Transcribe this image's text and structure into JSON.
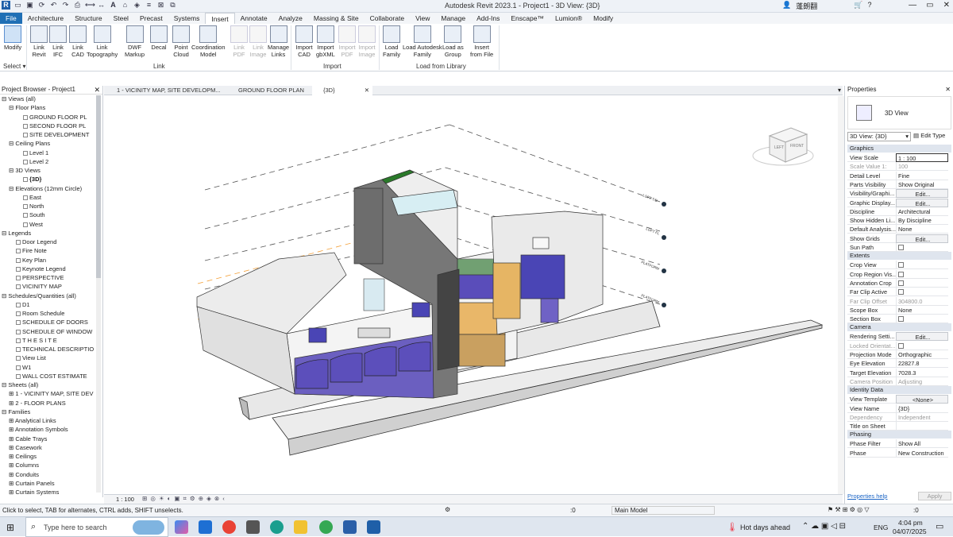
{
  "title_bar": {
    "title": "Autodesk Revit 2023.1 - Project1 - 3D View: {3D}",
    "user_label": "蓬朗翻",
    "window_controls": [
      "—",
      "▭",
      "✕"
    ]
  },
  "tabs": [
    "File",
    "Architecture",
    "Structure",
    "Steel",
    "Precast",
    "Systems",
    "Insert",
    "Annotate",
    "Analyze",
    "Massing & Site",
    "Collaborate",
    "View",
    "Manage",
    "Add-Ins",
    "Enscape™",
    "Lumion®",
    "Modify"
  ],
  "active_tab": "Insert",
  "ribbon": {
    "buttons": [
      {
        "l1": "Modify",
        "l2": "",
        "state": "sel"
      },
      {
        "l1": "Link",
        "l2": "Revit",
        "state": ""
      },
      {
        "l1": "Link",
        "l2": "IFC",
        "state": ""
      },
      {
        "l1": "Link",
        "l2": "CAD",
        "state": ""
      },
      {
        "l1": "Link",
        "l2": "Topography",
        "state": ""
      },
      {
        "l1": "DWF",
        "l2": "Markup",
        "state": ""
      },
      {
        "l1": "Decal",
        "l2": "",
        "state": ""
      },
      {
        "l1": "Point",
        "l2": "Cloud",
        "state": ""
      },
      {
        "l1": "Coordination",
        "l2": "Model",
        "state": ""
      },
      {
        "l1": "Link",
        "l2": "PDF",
        "state": "dis"
      },
      {
        "l1": "Link",
        "l2": "Image",
        "state": "dis"
      },
      {
        "l1": "Manage",
        "l2": "Links",
        "state": ""
      },
      {
        "l1": "Import",
        "l2": "CAD",
        "state": ""
      },
      {
        "l1": "Import",
        "l2": "gbXML",
        "state": ""
      },
      {
        "l1": "Import",
        "l2": "PDF",
        "state": "dis"
      },
      {
        "l1": "Import",
        "l2": "Image",
        "state": "dis"
      },
      {
        "l1": "Load",
        "l2": "Family",
        "state": ""
      },
      {
        "l1": "Load Autodesk",
        "l2": "Family",
        "state": ""
      },
      {
        "l1": "Load as",
        "l2": "Group",
        "state": ""
      },
      {
        "l1": "Insert",
        "l2": "from File",
        "state": ""
      }
    ],
    "groups": {
      "select": "Select ▾",
      "link": "Link",
      "import": "Import",
      "load": "Load from Library"
    }
  },
  "project_browser": {
    "title": "Project Browser - Project1",
    "rows": [
      {
        "t": "Views (all)",
        "d": 0,
        "e": "⊟"
      },
      {
        "t": "Floor Plans",
        "d": 1,
        "e": "⊟"
      },
      {
        "t": "GROUND FLOOR PL",
        "d": 3,
        "e": "",
        "b": 1
      },
      {
        "t": "SECOND FLOOR PL",
        "d": 3,
        "e": "",
        "b": 1
      },
      {
        "t": "SITE DEVELOPMENT",
        "d": 3,
        "e": "",
        "b": 1
      },
      {
        "t": "Ceiling Plans",
        "d": 1,
        "e": "⊟"
      },
      {
        "t": "Level 1",
        "d": 3,
        "e": "",
        "b": 1
      },
      {
        "t": "Level 2",
        "d": 3,
        "e": "",
        "b": 1
      },
      {
        "t": "3D Views",
        "d": 1,
        "e": "⊟"
      },
      {
        "t": "{3D}",
        "d": 3,
        "e": "",
        "b": 1,
        "bold": 1
      },
      {
        "t": "Elevations (12mm Circle)",
        "d": 1,
        "e": "⊟"
      },
      {
        "t": "East",
        "d": 3,
        "e": "",
        "b": 1
      },
      {
        "t": "North",
        "d": 3,
        "e": "",
        "b": 1
      },
      {
        "t": "South",
        "d": 3,
        "e": "",
        "b": 1
      },
      {
        "t": "West",
        "d": 3,
        "e": "",
        "b": 1
      },
      {
        "t": "Legends",
        "d": 0,
        "e": "⊟"
      },
      {
        "t": "Door Legend",
        "d": 2,
        "e": "",
        "b": 1
      },
      {
        "t": "Fire Note",
        "d": 2,
        "e": "",
        "b": 1
      },
      {
        "t": "Key Plan",
        "d": 2,
        "e": "",
        "b": 1
      },
      {
        "t": "Keynote Legend",
        "d": 2,
        "e": "",
        "b": 1
      },
      {
        "t": "PERSPECTIVE",
        "d": 2,
        "e": "",
        "b": 1
      },
      {
        "t": "VICINITY MAP",
        "d": 2,
        "e": "",
        "b": 1
      },
      {
        "t": "Schedules/Quantities (all)",
        "d": 0,
        "e": "⊟"
      },
      {
        "t": "D1",
        "d": 2,
        "e": "",
        "b": 1
      },
      {
        "t": "Room Schedule",
        "d": 2,
        "e": "",
        "b": 1
      },
      {
        "t": "SCHEDULE OF DOORS",
        "d": 2,
        "e": "",
        "b": 1
      },
      {
        "t": "SCHEDULE OF WINDOW",
        "d": 2,
        "e": "",
        "b": 1
      },
      {
        "t": "T H E  S I T E",
        "d": 2,
        "e": "",
        "b": 1
      },
      {
        "t": "TECHNICAL DESCRIPTIO",
        "d": 2,
        "e": "",
        "b": 1
      },
      {
        "t": "View List",
        "d": 2,
        "e": "",
        "b": 1
      },
      {
        "t": "W1",
        "d": 2,
        "e": "",
        "b": 1
      },
      {
        "t": "WALL COST ESTIMATE",
        "d": 2,
        "e": "",
        "b": 1
      },
      {
        "t": "Sheets (all)",
        "d": 0,
        "e": "⊟"
      },
      {
        "t": "1 - VICINITY MAP, SITE DEV",
        "d": 1,
        "e": "⊞"
      },
      {
        "t": "2 - FLOOR PLANS",
        "d": 1,
        "e": "⊞"
      },
      {
        "t": "Families",
        "d": 0,
        "e": "⊟"
      },
      {
        "t": "Analytical Links",
        "d": 1,
        "e": "⊞"
      },
      {
        "t": "Annotation Symbols",
        "d": 1,
        "e": "⊞"
      },
      {
        "t": "Cable Trays",
        "d": 1,
        "e": "⊞"
      },
      {
        "t": "Casework",
        "d": 1,
        "e": "⊞"
      },
      {
        "t": "Ceilings",
        "d": 1,
        "e": "⊞"
      },
      {
        "t": "Columns",
        "d": 1,
        "e": "⊞"
      },
      {
        "t": "Conduits",
        "d": 1,
        "e": "⊞"
      },
      {
        "t": "Curtain Panels",
        "d": 1,
        "e": "⊞"
      },
      {
        "t": "Curtain Systems",
        "d": 1,
        "e": "⊞"
      }
    ]
  },
  "view_tabs": [
    "1 - VICINITY MAP, SITE DEVELOPM...",
    "GROUND FLOOR PLAN",
    "{3D}"
  ],
  "viewcube": {
    "left": "LEFT",
    "front": "FRONT"
  },
  "level_tags": [
    "LOFT T/B",
    "LOFT FL",
    "PLATFORM",
    "PLATFORM"
  ],
  "view_bar": {
    "scale": "1 : 100"
  },
  "properties": {
    "title": "Properties",
    "type_name": "3D View",
    "instance_selector": "3D View: {3D}",
    "edit_type": "Edit Type",
    "sections": [
      {
        "name": "Graphics",
        "rows": [
          {
            "k": "View Scale",
            "v": "1 : 100",
            "kind": "input"
          },
          {
            "k": "Scale Value    1:",
            "v": "100",
            "kind": "dis"
          },
          {
            "k": "Detail Level",
            "v": "Fine",
            "kind": ""
          },
          {
            "k": "Parts Visibility",
            "v": "Show Original",
            "kind": ""
          },
          {
            "k": "Visibility/Graphi...",
            "v": "Edit...",
            "kind": "btn"
          },
          {
            "k": "Graphic Display...",
            "v": "Edit...",
            "kind": "btn"
          },
          {
            "k": "Discipline",
            "v": "Architectural",
            "kind": ""
          },
          {
            "k": "Show Hidden Li...",
            "v": "By Discipline",
            "kind": ""
          },
          {
            "k": "Default Analysis...",
            "v": "None",
            "kind": ""
          },
          {
            "k": "Show Grids",
            "v": "Edit...",
            "kind": "btn"
          },
          {
            "k": "Sun Path",
            "v": "",
            "kind": "cb"
          }
        ]
      },
      {
        "name": "Extents",
        "rows": [
          {
            "k": "Crop View",
            "v": "",
            "kind": "cb"
          },
          {
            "k": "Crop Region Vis...",
            "v": "",
            "kind": "cb"
          },
          {
            "k": "Annotation Crop",
            "v": "",
            "kind": "cb"
          },
          {
            "k": "Far Clip Active",
            "v": "",
            "kind": "cb"
          },
          {
            "k": "Far Clip Offset",
            "v": "304800.0",
            "kind": "dis"
          },
          {
            "k": "Scope Box",
            "v": "None",
            "kind": ""
          },
          {
            "k": "Section Box",
            "v": "",
            "kind": "cb"
          }
        ]
      },
      {
        "name": "Camera",
        "rows": [
          {
            "k": "Rendering Setti...",
            "v": "Edit...",
            "kind": "btn"
          },
          {
            "k": "Locked Orientat...",
            "v": "",
            "kind": "discb"
          },
          {
            "k": "Projection Mode",
            "v": "Orthographic",
            "kind": ""
          },
          {
            "k": "Eye Elevation",
            "v": "22827.8",
            "kind": ""
          },
          {
            "k": "Target Elevation",
            "v": "7028.3",
            "kind": ""
          },
          {
            "k": "Camera Position",
            "v": "Adjusting",
            "kind": "dis"
          }
        ]
      },
      {
        "name": "Identity Data",
        "rows": [
          {
            "k": "View Template",
            "v": "<None>",
            "kind": "btn"
          },
          {
            "k": "View Name",
            "v": "{3D}",
            "kind": ""
          },
          {
            "k": "Dependency",
            "v": "Independent",
            "kind": "dis"
          },
          {
            "k": "Title on Sheet",
            "v": "",
            "kind": ""
          }
        ]
      },
      {
        "name": "Phasing",
        "rows": [
          {
            "k": "Phase Filter",
            "v": "Show All",
            "kind": ""
          },
          {
            "k": "Phase",
            "v": "New Construction",
            "kind": ""
          }
        ]
      }
    ],
    "help_link": "Properties help",
    "apply": "Apply"
  },
  "status": {
    "hint": "Click to select, TAB for alternates, CTRL adds, SHIFT unselects.",
    "selection_count": ":0",
    "model": "Main Model",
    "filter_count": ":0"
  },
  "taskbar": {
    "search_placeholder": "Type here to search",
    "weather": "Hot days ahead",
    "lang": "ENG",
    "time": "4:04 pm",
    "date": "04/07/2025"
  }
}
